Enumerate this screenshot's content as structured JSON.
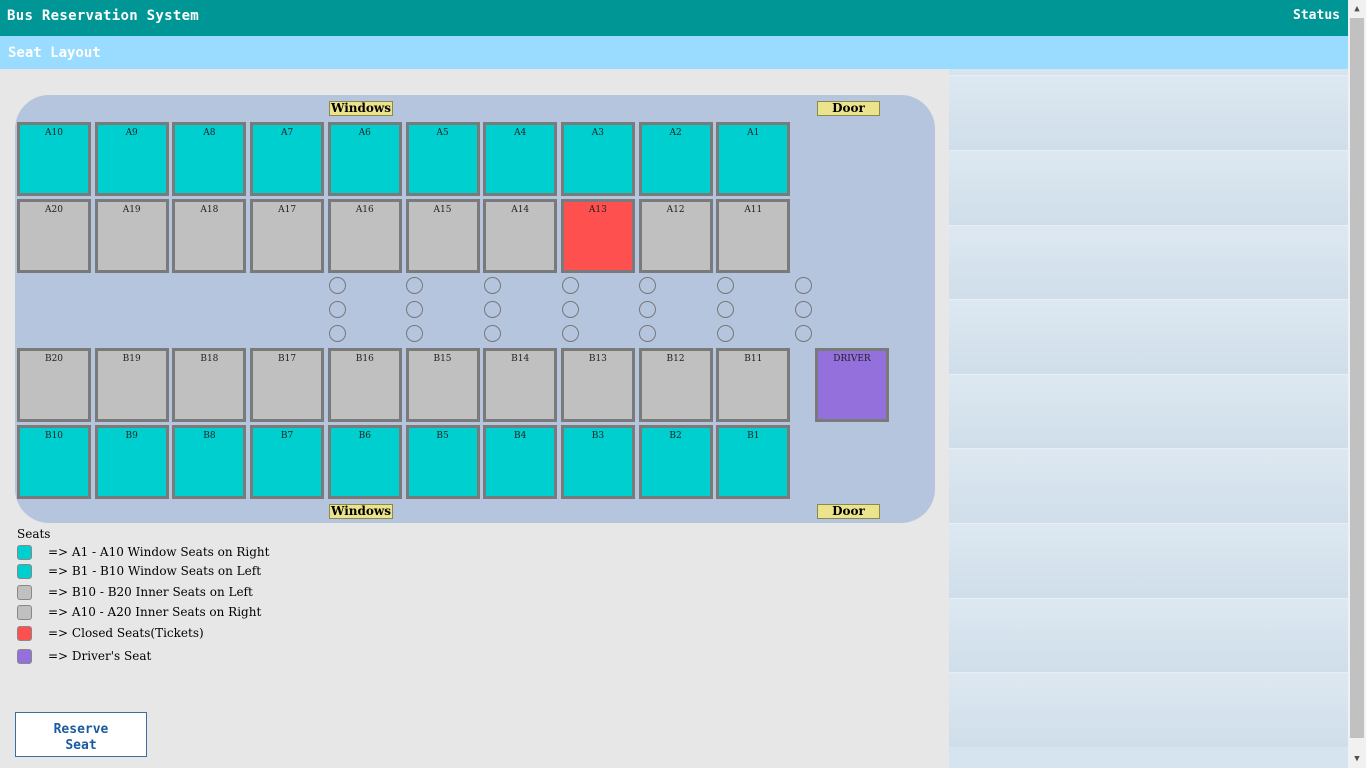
{
  "header": {
    "title": "Bus Reservation System",
    "status_label": "Status"
  },
  "subheader": {
    "title": "Seat Layout"
  },
  "bus": {
    "window_label": "Windows",
    "door_label": "Door",
    "driver_label": "DRIVER",
    "rows": [
      [
        {
          "id": "A10",
          "type": "window"
        },
        {
          "id": "A9",
          "type": "window"
        },
        {
          "id": "A8",
          "type": "window"
        },
        {
          "id": "A7",
          "type": "window"
        },
        {
          "id": "A6",
          "type": "window"
        },
        {
          "id": "A5",
          "type": "window"
        },
        {
          "id": "A4",
          "type": "window"
        },
        {
          "id": "A3",
          "type": "window"
        },
        {
          "id": "A2",
          "type": "window"
        },
        {
          "id": "A1",
          "type": "window"
        }
      ],
      [
        {
          "id": "A20",
          "type": "inner"
        },
        {
          "id": "A19",
          "type": "inner"
        },
        {
          "id": "A18",
          "type": "inner"
        },
        {
          "id": "A17",
          "type": "inner"
        },
        {
          "id": "A16",
          "type": "inner"
        },
        {
          "id": "A15",
          "type": "inner"
        },
        {
          "id": "A14",
          "type": "inner"
        },
        {
          "id": "A13",
          "type": "closed"
        },
        {
          "id": "A12",
          "type": "inner"
        },
        {
          "id": "A11",
          "type": "inner"
        }
      ],
      [
        {
          "id": "B20",
          "type": "inner"
        },
        {
          "id": "B19",
          "type": "inner"
        },
        {
          "id": "B18",
          "type": "inner"
        },
        {
          "id": "B17",
          "type": "inner"
        },
        {
          "id": "B16",
          "type": "inner"
        },
        {
          "id": "B15",
          "type": "inner"
        },
        {
          "id": "B14",
          "type": "inner"
        },
        {
          "id": "B13",
          "type": "inner"
        },
        {
          "id": "B12",
          "type": "inner"
        },
        {
          "id": "B11",
          "type": "inner"
        }
      ],
      [
        {
          "id": "B10",
          "type": "window"
        },
        {
          "id": "B9",
          "type": "window"
        },
        {
          "id": "B8",
          "type": "window"
        },
        {
          "id": "B7",
          "type": "window"
        },
        {
          "id": "B6",
          "type": "window"
        },
        {
          "id": "B5",
          "type": "window"
        },
        {
          "id": "B4",
          "type": "window"
        },
        {
          "id": "B3",
          "type": "window"
        },
        {
          "id": "B2",
          "type": "window"
        },
        {
          "id": "B1",
          "type": "window"
        }
      ]
    ]
  },
  "legend": {
    "title": "Seats",
    "items": [
      {
        "text": "=> A1 - A10 Window Seats on Right",
        "color": "#00cfcf"
      },
      {
        "text": "=> B1 - B10 Window Seats on Left",
        "color": "#00cfcf"
      },
      {
        "text": "=> B10 - B20 Inner Seats on Left",
        "color": "#c0c0c0"
      },
      {
        "text": "=> A10 - A20 Inner Seats on Right",
        "color": "#c0c0c0"
      },
      {
        "text": "=> Closed Seats(Tickets)",
        "color": "#ff5050"
      },
      {
        "text": "=> Driver's Seat",
        "color": "#9370db"
      }
    ]
  },
  "actions": {
    "reserve_label": "Reserve Seat"
  },
  "colors": {
    "header": "#009696",
    "subheader": "#99dcff",
    "window": "#00cfcf",
    "inner": "#c0c0c0",
    "closed": "#ff5050",
    "driver": "#9370db"
  }
}
